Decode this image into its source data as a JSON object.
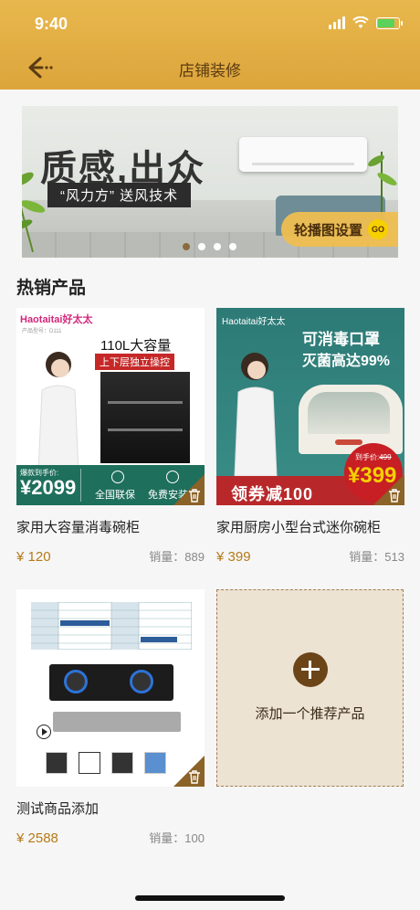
{
  "status_bar": {
    "time": "9:40"
  },
  "header": {
    "title": "店铺装修"
  },
  "banner": {
    "slogan": "质感,出众",
    "subtitle": "“风力方” 送风技术",
    "dots": 4,
    "active_dot": 0,
    "button_label": "轮播图设置",
    "go_badge": "GO"
  },
  "section": {
    "title": "热销产品"
  },
  "products": [
    {
      "name": "家用大容量消毒碗柜",
      "price": "¥ 120",
      "sales": "销量：889",
      "image": {
        "brand": "Haotaitai好太太",
        "model": "产品型号：D111",
        "capacity": "110L大容量",
        "feature": "上下层独立操控",
        "price_label": "爆款到手价:",
        "price": "¥2099",
        "service1": "全国联保",
        "service2": "免费安装"
      }
    },
    {
      "name": "家用厨房小型台式迷你碗柜",
      "price": "¥ 399",
      "sales": "销量：513",
      "image": {
        "brand": "Haotaitai好太太",
        "headline1": "可消毒口罩",
        "headline2": "灭菌高达99%",
        "coupon": "领券减100",
        "arrival_label": "到手价:",
        "old_price": "499",
        "price": "¥399"
      }
    },
    {
      "name": "测试商品添加",
      "price": "¥ 2588",
      "sales": "销量：100"
    }
  ],
  "add_product": {
    "label": "添加一个推荐产品"
  },
  "colors": {
    "header": "#e0ab42",
    "accent_brown": "#8b6227",
    "price": "#b57a18"
  }
}
